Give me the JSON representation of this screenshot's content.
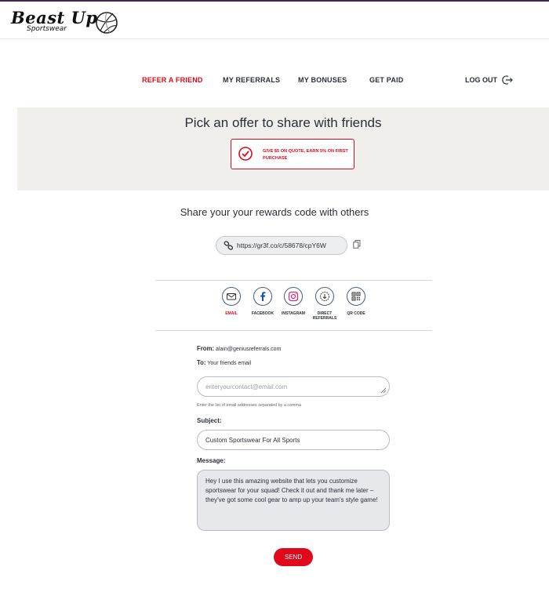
{
  "brand": {
    "name": "Beast Up",
    "tagline": "Sportswear"
  },
  "nav": {
    "items": [
      {
        "label": "REFER A FRIEND",
        "active": true
      },
      {
        "label": "MY REFERRALS"
      },
      {
        "label": "MY BONUSES"
      },
      {
        "label": "GET PAID"
      }
    ],
    "logout": "LOG OUT"
  },
  "offer": {
    "title": "Pick an offer to share with friends",
    "card_text": "GIVE $5 ON QUOTE, EARN 5% ON FIRST PURCHASE"
  },
  "share": {
    "title": "Share your your rewards code with others",
    "link": "https://gr3f.co/c/58678/cpY6W",
    "options": [
      {
        "label": "EMAIL",
        "icon": "mail-icon",
        "active": true
      },
      {
        "label": "FACEBOOK",
        "icon": "facebook-icon"
      },
      {
        "label": "INSTAGRAM",
        "icon": "instagram-icon"
      },
      {
        "label": "DIRECT REFERRALS",
        "icon": "direct-referrals-icon"
      },
      {
        "label": "QR CODE",
        "icon": "qr-code-icon"
      }
    ]
  },
  "form": {
    "from_label": "From:",
    "from_value": "alain@geniusreferrals.com",
    "to_label": "To:",
    "to_value": "Your friends email",
    "email_placeholder": "enteryourcontact@email.com",
    "hint": "Enter the list of email addresses separated by a comma",
    "subject_label": "Subject:",
    "subject_value": "Custom Sportswear For All Sports",
    "message_label": "Message:",
    "message_value": "Hey I use this amazing website that lets you customize sportswear for your squad! Check it out and thank me later – they've got some cool gear to amp up your team's style game!",
    "send_label": "SEND"
  },
  "colors": {
    "accent": "#e0091b",
    "panel": "#f0efeb",
    "text": "#2b2f3a"
  }
}
